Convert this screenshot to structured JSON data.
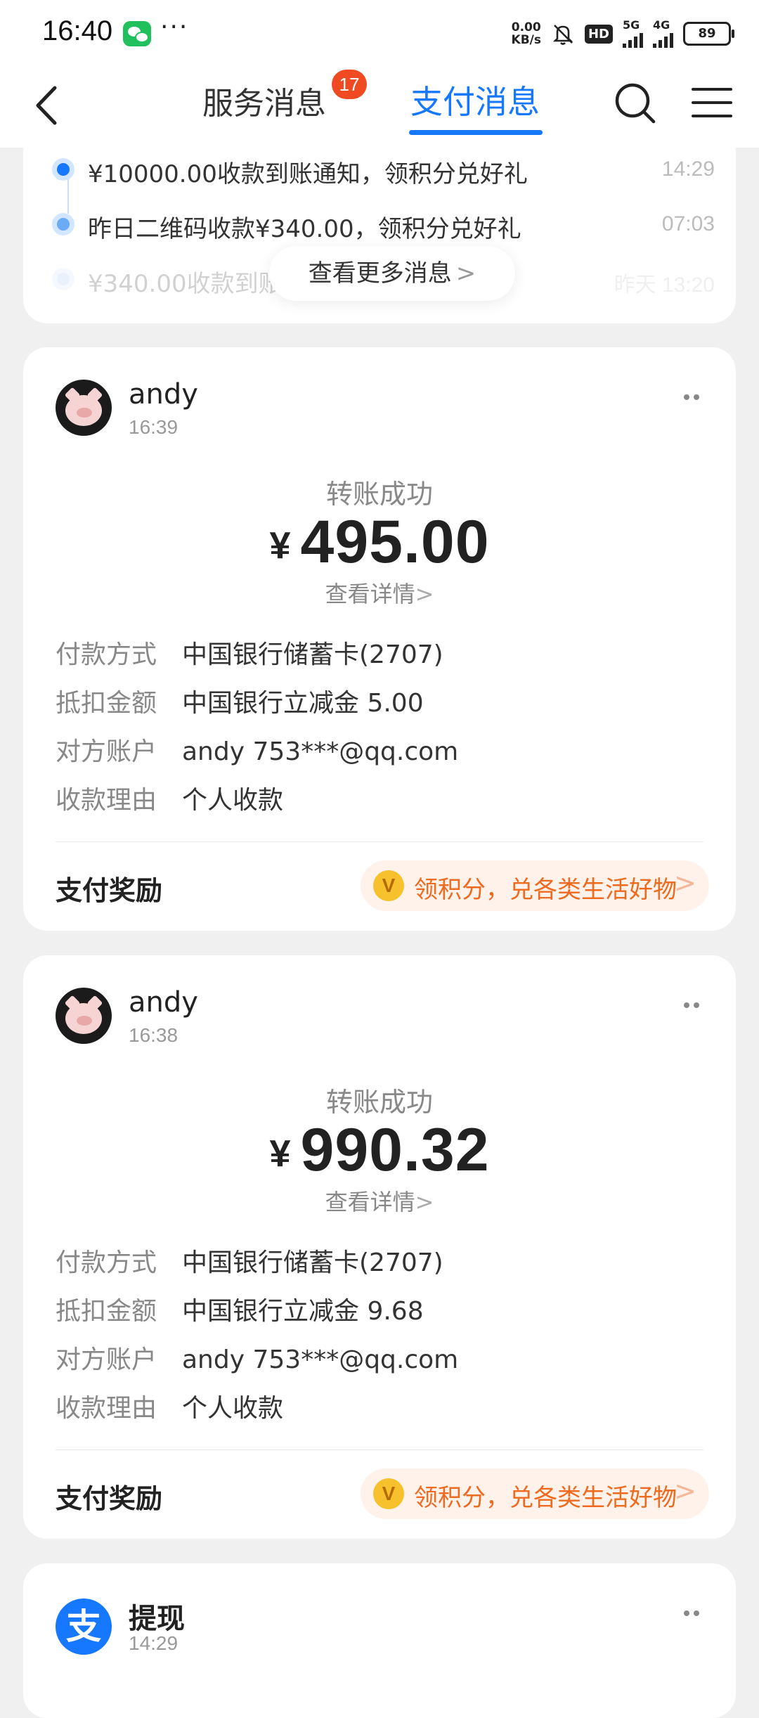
{
  "status_bar": {
    "time": "16:40",
    "net_speed_value": "0.00",
    "net_speed_unit": "KB/s",
    "hd": "HD",
    "sig1": "5G",
    "sig2": "4G",
    "battery": "89"
  },
  "nav": {
    "tab_service": "服务消息",
    "badge": "17",
    "tab_pay": "支付消息",
    "accent": "#1677ff"
  },
  "history": {
    "items": [
      {
        "text": "¥10000.00收款到账通知，领积分兑好礼",
        "time": "14:29"
      },
      {
        "text": "昨日二维码收款¥340.00，领积分兑好礼",
        "time": "07:03"
      },
      {
        "text": "¥340.00收款到账通知，领积分兑好礼",
        "time": "昨天 13:20"
      }
    ],
    "more_button": "查看更多消息",
    "chevron": ">"
  },
  "transactions": [
    {
      "name": "andy",
      "time": "16:39",
      "status": "转账成功",
      "currency": "¥",
      "amount": "495.00",
      "detail_link": "查看详情",
      "rows": [
        {
          "k": "付款方式",
          "v": "中国银行储蓄卡(2707)"
        },
        {
          "k": "抵扣金额",
          "v": "中国银行立减金 5.00"
        },
        {
          "k": "对方账户",
          "v": "andy 753***@qq.com"
        },
        {
          "k": "收款理由",
          "v": "个人收款"
        }
      ],
      "reward_label": "支付奖励",
      "reward_coin": "V",
      "reward_text": "领积分，兑各类生活好物"
    },
    {
      "name": "andy",
      "time": "16:38",
      "status": "转账成功",
      "currency": "¥",
      "amount": "990.32",
      "detail_link": "查看详情",
      "rows": [
        {
          "k": "付款方式",
          "v": "中国银行储蓄卡(2707)"
        },
        {
          "k": "抵扣金额",
          "v": "中国银行立减金 9.68"
        },
        {
          "k": "对方账户",
          "v": "andy 753***@qq.com"
        },
        {
          "k": "收款理由",
          "v": "个人收款"
        }
      ],
      "reward_label": "支付奖励",
      "reward_coin": "V",
      "reward_text": "领积分，兑各类生活好物"
    }
  ],
  "withdraw": {
    "logo": "支",
    "title": "提现",
    "time": "14:29"
  }
}
